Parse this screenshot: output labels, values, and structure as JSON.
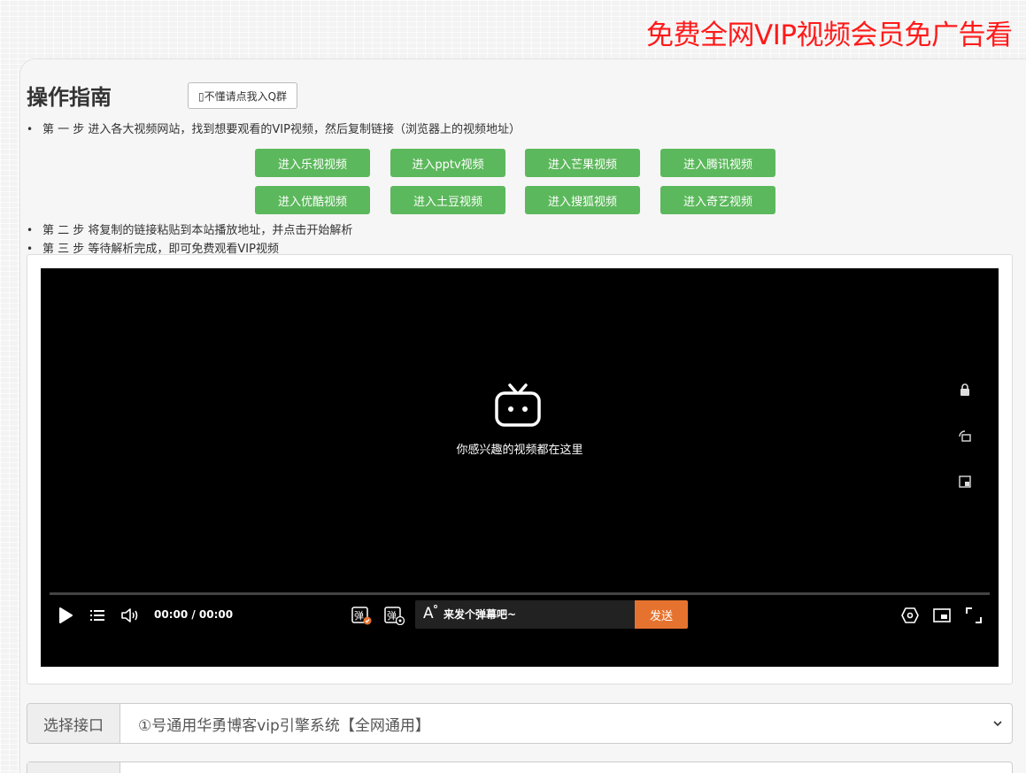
{
  "banner": "免费全网VIP视频会员免广告看",
  "guide": {
    "title": "操作指南",
    "qq_button": "▯不懂请点我入Q群",
    "step1": "第 一 步 进入各大视频网站，找到想要观看的VIP视频，然后复制链接（浏览器上的视频地址）",
    "step2": "第 二 步 将复制的链接粘贴到本站播放地址，并点击开始解析",
    "step3": "第 三 步 等待解析完成，即可免费观看VIP视频",
    "bullet": "•"
  },
  "sites": [
    "进入乐视视频",
    "进入pptv视频",
    "进入芒果视频",
    "进入腾讯视频",
    "进入优酷视频",
    "进入土豆视频",
    "进入搜狐视频",
    "进入奇艺视频"
  ],
  "player": {
    "tagline": "你感兴趣的视频都在这里",
    "time": "00:00 / 00:00",
    "danmaku_placeholder": "来发个弹幕吧~",
    "send_label": "发送",
    "danmaku_toggle_glyph": "弹",
    "danmaku_settings_glyph": "弹",
    "font_glyph": "A",
    "icons": {
      "play": "play-icon",
      "playlist": "playlist-icon",
      "volume": "volume-icon",
      "lock": "lock-icon",
      "rotate": "rotate-icon",
      "pip": "pip-icon",
      "settings": "settings-icon",
      "widescreen": "widescreen-icon",
      "fullscreen": "fullscreen-icon"
    },
    "progress": 0
  },
  "interface": {
    "label": "选择接口",
    "selected": "①号通用华勇博客vip引擎系统【全网通用】"
  },
  "colors": {
    "banner": "#ff1a1a",
    "site_button": "#5cb85c",
    "send_button": "#e5732f",
    "player_bg": "#000000"
  }
}
